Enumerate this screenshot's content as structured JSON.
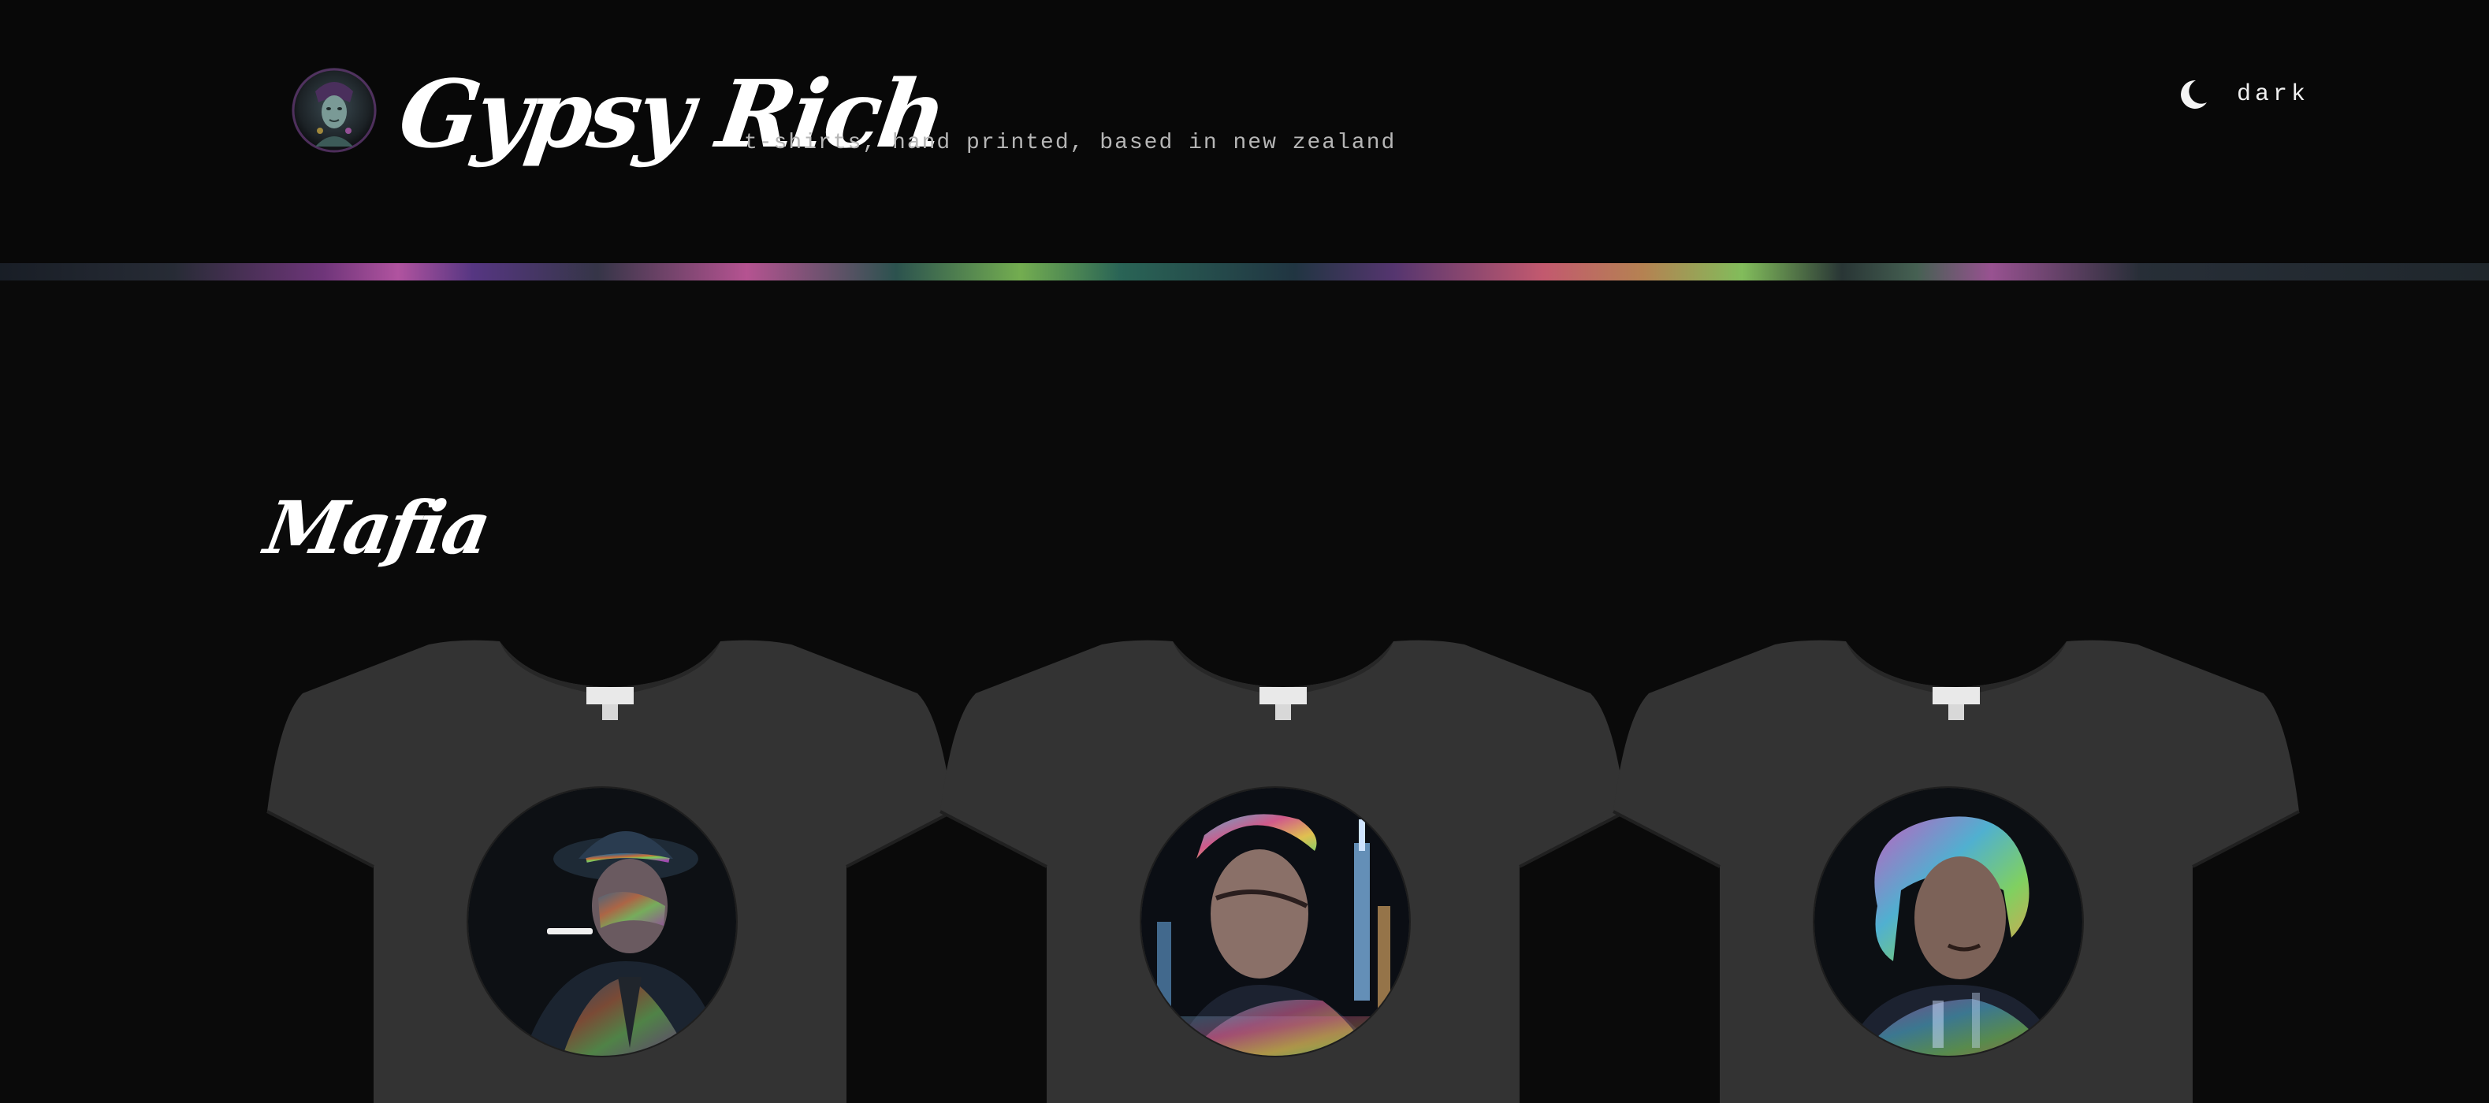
{
  "header": {
    "brand": "Gypsy Rich",
    "tagline": "t-shirts, hand printed, based in new zealand",
    "theme_toggle": {
      "label": "dark",
      "icon": "moon-icon"
    }
  },
  "section": {
    "title": "Mafia"
  },
  "products": [
    {
      "design": "mafia-man-hat-cigar"
    },
    {
      "design": "man-city-skyline"
    },
    {
      "design": "man-curly-hair-skyline"
    }
  ],
  "colors": {
    "background": "#0a0a0a",
    "header_background": "#080808",
    "shirt": "#333333",
    "text": "#ffffff",
    "muted_text": "#b6b6b6"
  }
}
